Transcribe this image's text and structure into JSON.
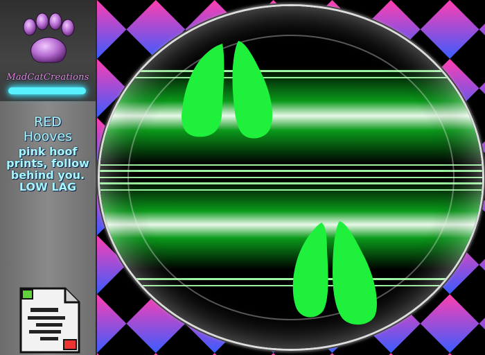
{
  "brand": {
    "name": "MadCatCreations"
  },
  "description": {
    "line1": "RED",
    "line2": "Hooves",
    "body": "pink hoof prints, follow behind you. LOW LAG"
  },
  "colors": {
    "hoof_green": "#1ef03c",
    "check_pink": "#e830b4",
    "check_blue": "#4a55e8",
    "glow_cyan": "#57f2ff",
    "paw_purple": "#b56ad0"
  },
  "icons": {
    "logo": "paw-print-icon",
    "document": "notecard-icon"
  }
}
